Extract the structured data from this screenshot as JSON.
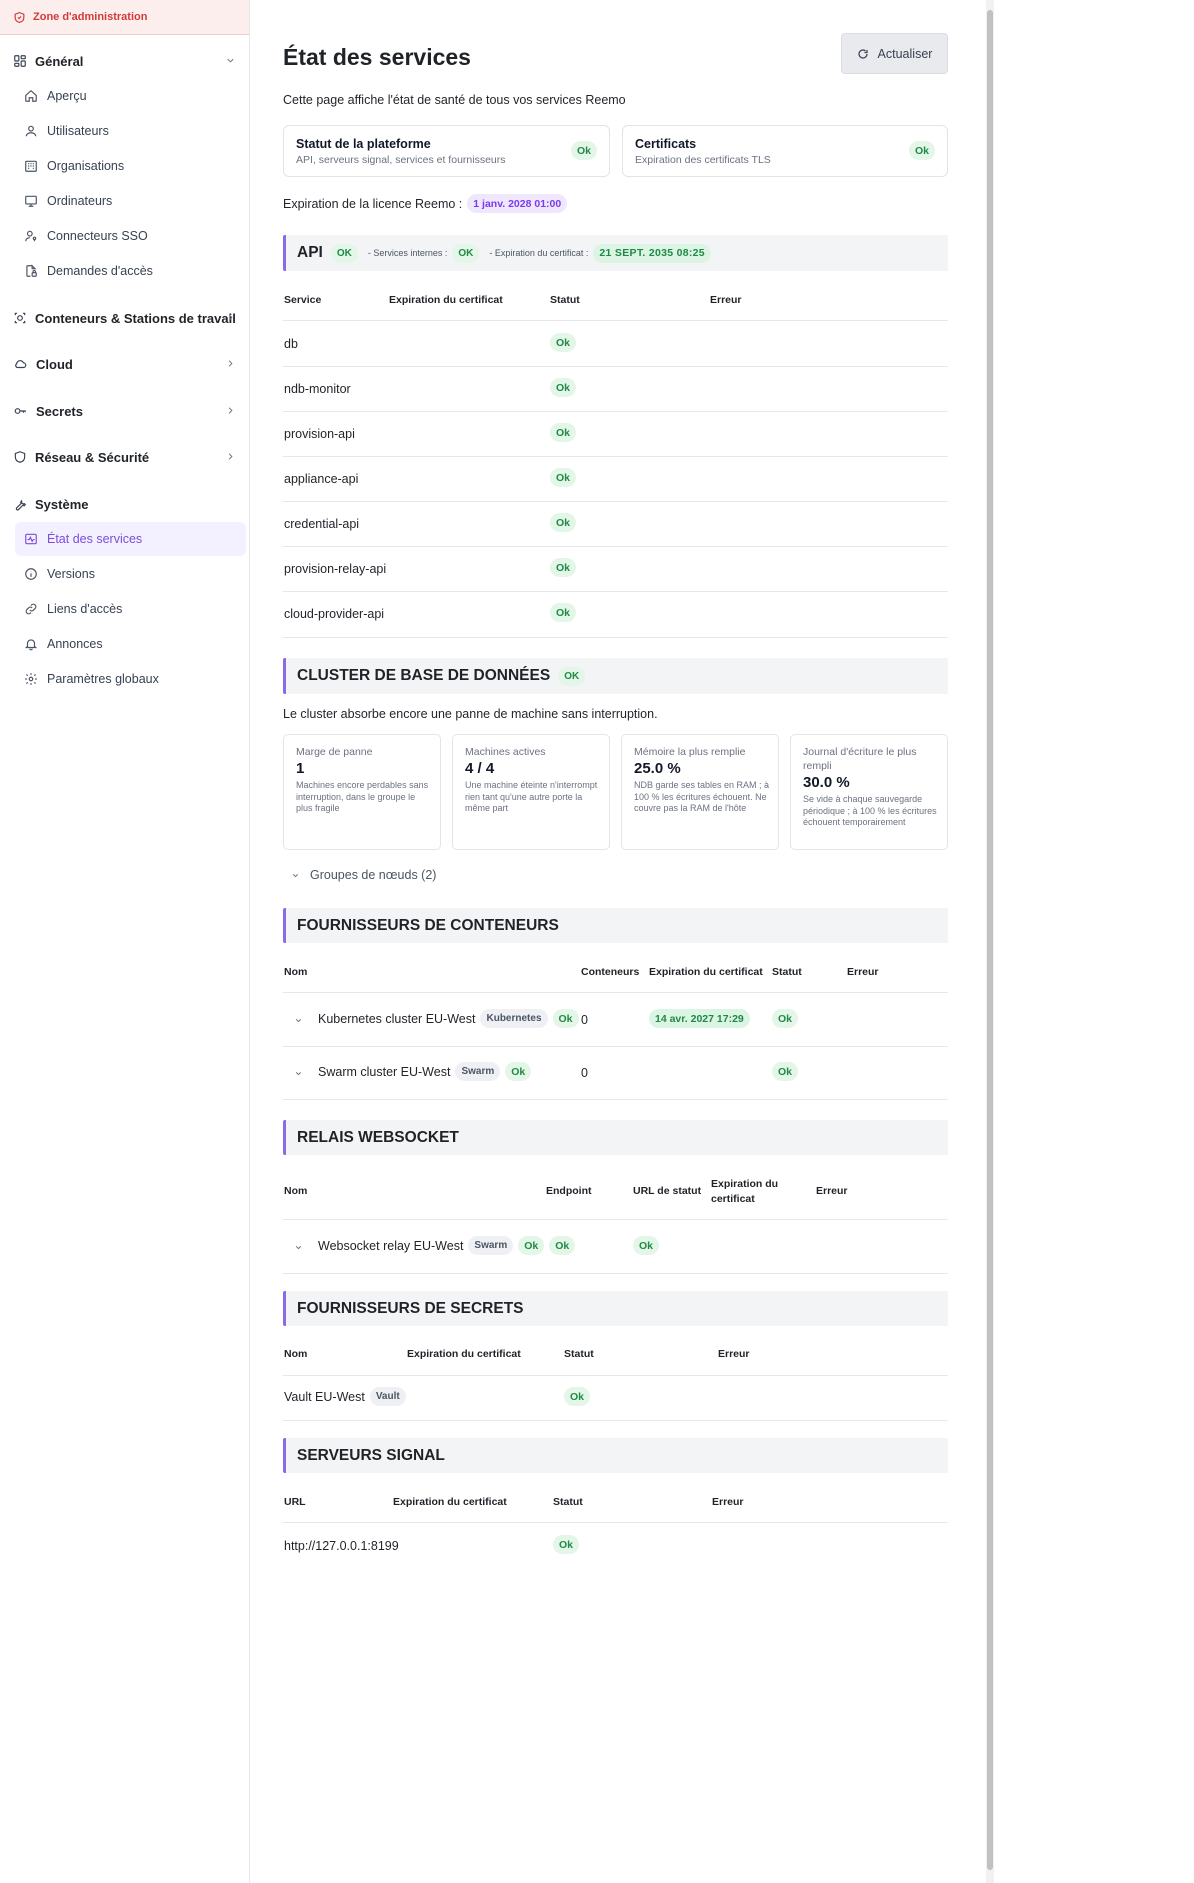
{
  "sidebar": {
    "admin_zone": "Zone d'administration",
    "groups": {
      "general": "Général",
      "containers": "Conteneurs & Stations de travail",
      "cloud": "Cloud",
      "secrets": "Secrets",
      "network": "Réseau & Sécurité",
      "system": "Système"
    },
    "general_items": [
      "Aperçu",
      "Utilisateurs",
      "Organisations",
      "Ordinateurs",
      "Connecteurs SSO",
      "Demandes d'accès"
    ],
    "system_items": [
      "État des services",
      "Versions",
      "Liens d'accès",
      "Annonces",
      "Paramètres globaux"
    ],
    "active_item": "État des services",
    "colors": {
      "active_bg": "#f3f0ff",
      "active_text": "#7c4ddb",
      "admin_text": "#d23a3a"
    }
  },
  "header": {
    "title": "État des services",
    "refresh_label": "Actualiser",
    "description": "Cette page affiche l'état de santé de tous vos services Reemo"
  },
  "status_cards": [
    {
      "title": "Statut de la plateforme",
      "subtitle": "API, serveurs signal, services et fournisseurs",
      "status": "Ok"
    },
    {
      "title": "Certificats",
      "subtitle": "Expiration des certificats TLS",
      "status": "Ok"
    }
  ],
  "license": {
    "label": "Expiration de la licence Reemo :",
    "value": "1 janv. 2028 01:00"
  },
  "api": {
    "title": "API",
    "status": "OK",
    "internal_label": "- Services internes :",
    "internal_status": "OK",
    "cert_label": "- Expiration du certificat :",
    "cert_value": "21 SEPT. 2035 08:25",
    "columns": [
      "Service",
      "Expiration du certificat",
      "Statut",
      "Erreur"
    ],
    "rows": [
      {
        "name": "db",
        "status": "Ok"
      },
      {
        "name": "ndb-monitor",
        "status": "Ok"
      },
      {
        "name": "provision-api",
        "status": "Ok"
      },
      {
        "name": "appliance-api",
        "status": "Ok"
      },
      {
        "name": "credential-api",
        "status": "Ok"
      },
      {
        "name": "provision-relay-api",
        "status": "Ok"
      },
      {
        "name": "cloud-provider-api",
        "status": "Ok"
      }
    ]
  },
  "db_cluster": {
    "title": "CLUSTER DE BASE DE DONNÉES",
    "status": "OK",
    "summary": "Le cluster absorbe encore une panne de machine sans interruption.",
    "metrics": [
      {
        "label": "Marge de panne",
        "value": "1",
        "desc": "Machines encore perdables sans interruption, dans le groupe le plus fragile"
      },
      {
        "label": "Machines actives",
        "value": "4 / 4",
        "desc": "Une machine éteinte n'interrompt rien tant qu'une autre porte la même part"
      },
      {
        "label": "Mémoire la plus remplie",
        "value": "25.0 %",
        "desc": "NDB garde ses tables en RAM ; à 100 % les écritures échouent. Ne couvre pas la RAM de l'hôte"
      },
      {
        "label": "Journal d'écriture le plus rempli",
        "value": "30.0 %",
        "desc": "Se vide à chaque sauvegarde périodique ; à 100 % les écritures échouent temporairement"
      }
    ],
    "node_groups": "Groupes de nœuds (2)"
  },
  "container_providers": {
    "title": "FOURNISSEURS DE CONTENEURS",
    "columns": [
      "Nom",
      "Conteneurs",
      "Expiration du certificat",
      "Statut",
      "Erreur"
    ],
    "rows": [
      {
        "name": "Kubernetes cluster EU-West",
        "type": "Kubernetes",
        "type_status": "Ok",
        "containers": "0",
        "cert": "14 avr. 2027 17:29",
        "status": "Ok"
      },
      {
        "name": "Swarm cluster EU-West",
        "type": "Swarm",
        "type_status": "Ok",
        "containers": "0",
        "cert": "",
        "status": "Ok"
      }
    ]
  },
  "websocket": {
    "title": "RELAIS WEBSOCKET",
    "columns": [
      "Nom",
      "Endpoint",
      "URL de statut",
      "Expiration du certificat",
      "Erreur"
    ],
    "rows": [
      {
        "name": "Websocket relay EU-West",
        "type": "Swarm",
        "type_status": "Ok",
        "endpoint": "Ok",
        "status_url": "Ok"
      }
    ]
  },
  "secret_providers": {
    "title": "FOURNISSEURS DE SECRETS",
    "columns": [
      "Nom",
      "Expiration du certificat",
      "Statut",
      "Erreur"
    ],
    "rows": [
      {
        "name": "Vault EU-West",
        "type": "Vault",
        "status": "Ok"
      }
    ]
  },
  "signal_servers": {
    "title": "SERVEURS SIGNAL",
    "columns": [
      "URL",
      "Expiration du certificat",
      "Statut",
      "Erreur"
    ],
    "rows": [
      {
        "url": "http://127.0.0.1:8199",
        "status": "Ok"
      }
    ]
  },
  "colors": {
    "ok_bg": "#e3f6e8",
    "ok_text": "#1f8a45",
    "accent": "#8b6ae6",
    "license_bg": "#efe7fb",
    "license_text": "#7c3aed"
  }
}
